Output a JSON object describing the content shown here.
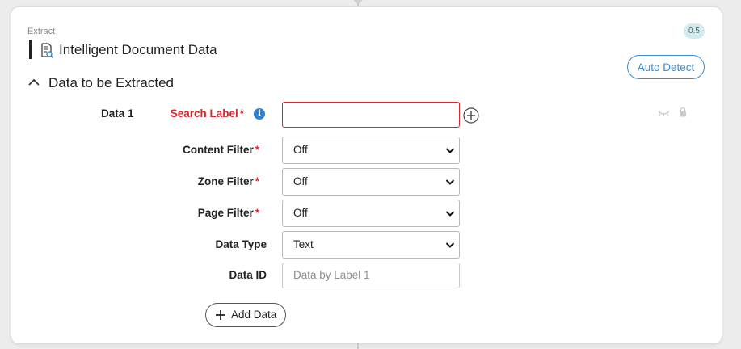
{
  "header": {
    "category": "Extract",
    "title": "Intelligent Document Data",
    "version": "0.5",
    "auto_detect_label": "Auto Detect"
  },
  "section": {
    "title": "Data to be Extracted"
  },
  "data_item": {
    "label": "Data 1",
    "search_label": {
      "label": "Search Label",
      "value": "",
      "info": "i"
    },
    "content_filter": {
      "label": "Content Filter",
      "value": "Off"
    },
    "zone_filter": {
      "label": "Zone Filter",
      "value": "Off"
    },
    "page_filter": {
      "label": "Page Filter",
      "value": "Off"
    },
    "data_type": {
      "label": "Data Type",
      "value": "Text"
    },
    "data_id": {
      "label": "Data ID",
      "placeholder": "Data by Label 1"
    }
  },
  "actions": {
    "add_data_label": "Add Data"
  },
  "colors": {
    "accent": "#3d8bd0",
    "required": "#d9262c",
    "badge_bg": "#d3ecef"
  },
  "icons": {
    "title_icon": "document-search-icon",
    "collapse_icon": "chevron-up-icon",
    "add_icon": "plus-circle-icon",
    "visibility_icon": "eye-closed-icon",
    "lock_icon": "lock-icon"
  }
}
